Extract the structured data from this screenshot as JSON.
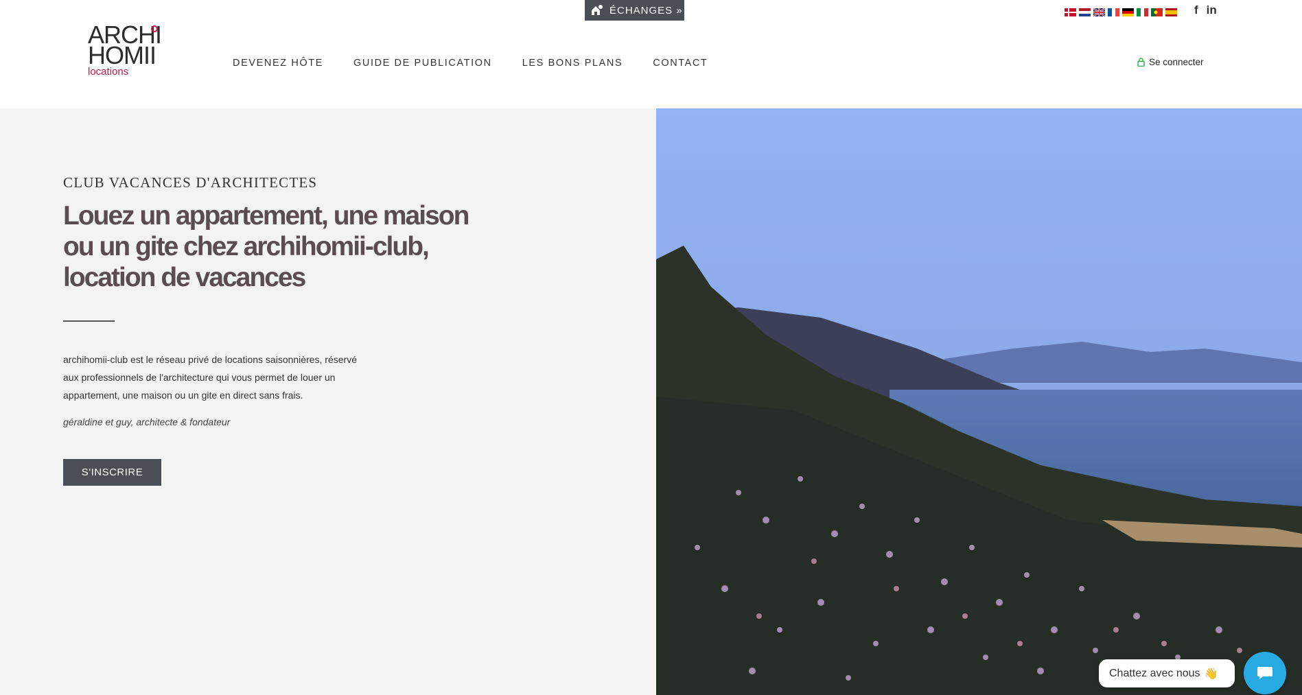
{
  "topbar": {
    "echanges_label": "ÉCHANGES »",
    "flags": [
      "danish-flag",
      "dutch-flag",
      "uk-flag",
      "french-flag",
      "german-flag",
      "italian-flag",
      "portuguese-flag",
      "spanish-flag"
    ],
    "social": {
      "facebook": "f",
      "linkedin": "in"
    }
  },
  "logo": {
    "line1": "ARCHI",
    "line2": "HOMII",
    "line3": "locations"
  },
  "nav": {
    "items": [
      {
        "label": "DEVENEZ HÔTE"
      },
      {
        "label": "GUIDE DE PUBLICATION"
      },
      {
        "label": "LES BONS PLANS"
      },
      {
        "label": "CONTACT"
      }
    ],
    "login_label": "Se connecter"
  },
  "hero": {
    "kicker": "CLUB VACANCES D'ARCHITECTES",
    "headline": "Louez un appartement, une maison ou un gite chez archihomii-club, location de vacances",
    "description": "archihomii-club est le réseau privé de locations saisonnières, réservé aux professionnels de l'architecture qui vous permet de louer un appartement, une maison ou un gite en direct sans frais.",
    "signature": "géraldine et guy, architecte & fondateur",
    "cta_label": "S'INSCRIRE"
  },
  "chat": {
    "bubble_text": "Chattez avec nous",
    "emoji": "👋"
  },
  "colors": {
    "dark_button": "#4b4f55",
    "accent_red": "#c7184a",
    "chat_blue": "#29a9e1",
    "hero_bg": "#f3f3f3"
  }
}
